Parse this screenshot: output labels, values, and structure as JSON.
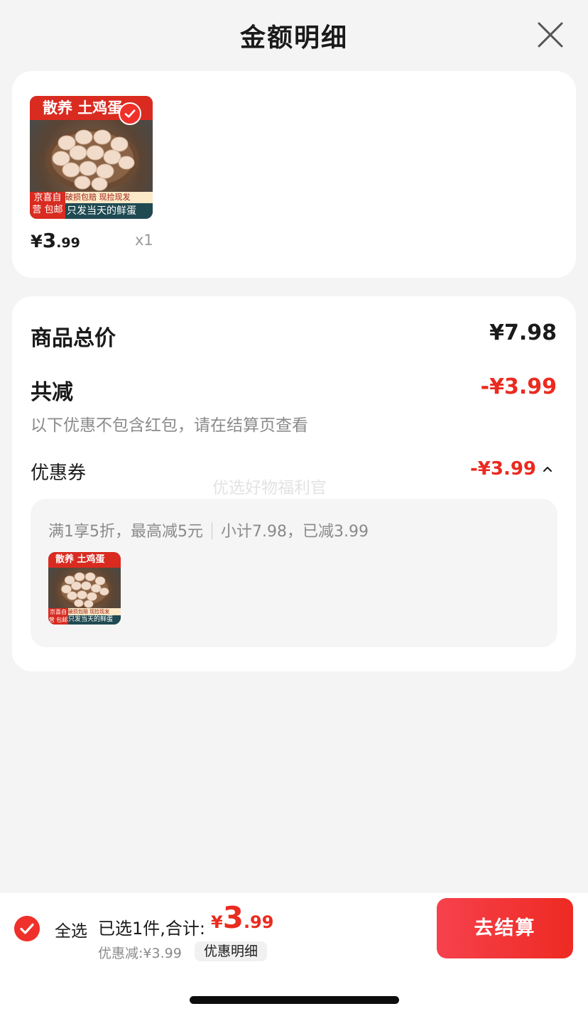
{
  "header": {
    "title": "金额明细"
  },
  "product": {
    "image_banner": "散养 土鸡蛋",
    "image_mid": "破损包赔 现捡现发",
    "image_bottom": "只发当天的鲜蛋",
    "image_corner": "京喜自营 包邮",
    "price_currency": "¥",
    "price_int": "3",
    "price_dec": ".99",
    "quantity": "x1"
  },
  "summary": {
    "total_label": "商品总价",
    "total_value": "¥7.98",
    "discount_label": "共减",
    "discount_value": "-¥3.99",
    "hint": "以下优惠不包含红包，请在结算页查看",
    "coupon_label": "优惠券",
    "coupon_value": "-¥3.99",
    "watermark": "优选好物福利官",
    "coupon_rule": "满1享5折，最高减5元",
    "coupon_subtotal": "小计7.98，已减3.99"
  },
  "bottom_bar": {
    "select_all": "全选",
    "selected_text": "已选1件,合计:",
    "total_currency": "¥",
    "total_int": "3",
    "total_dec": ".99",
    "discount_text": "优惠减:¥3.99",
    "detail_button": "优惠明细",
    "checkout_button": "去结算"
  },
  "colors": {
    "accent": "#ea2b20",
    "background": "#f4f4f4",
    "card": "#ffffff"
  }
}
